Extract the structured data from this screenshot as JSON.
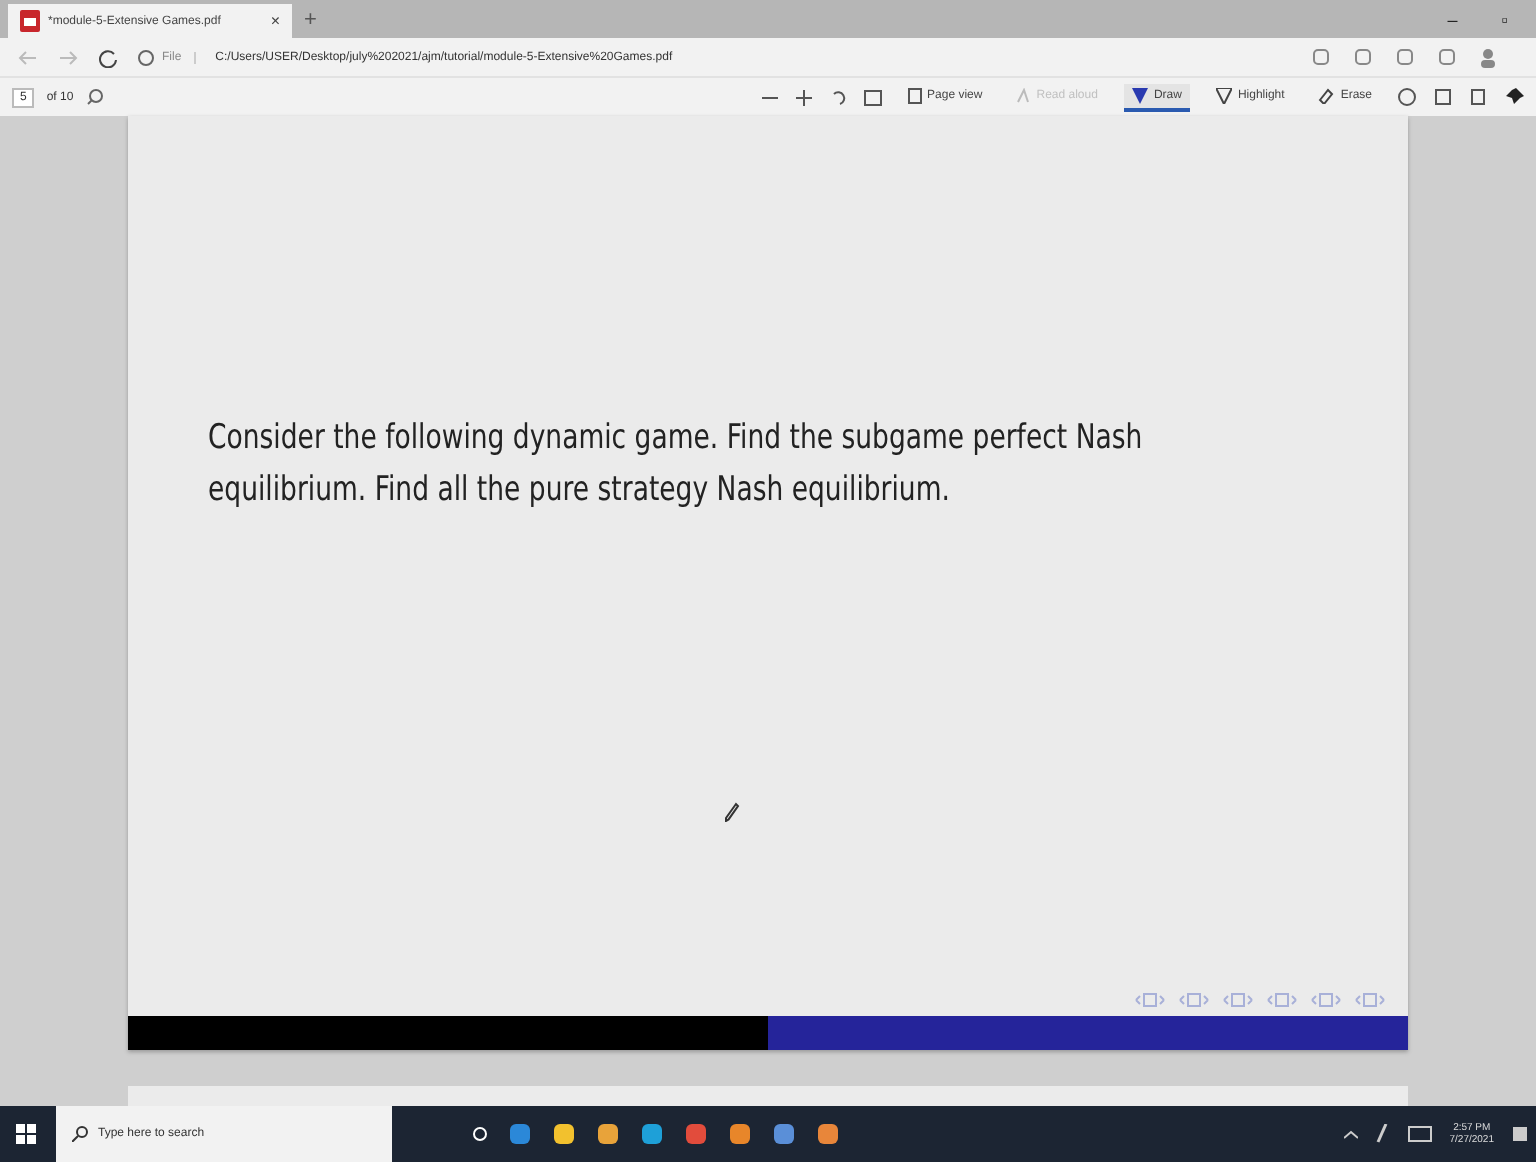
{
  "browser": {
    "tab": {
      "title": "*module-5-Extensive Games.pdf",
      "close": "×"
    },
    "new_tab": "+",
    "window_controls": [
      "–",
      "▫"
    ],
    "address": {
      "scheme": "File",
      "url": "C:/Users/USER/Desktop/july%202021/ajm/tutorial/module-5-Extensive%20Games.pdf"
    }
  },
  "pdf_toolbar": {
    "page": "5",
    "page_count": "of 10",
    "tools": [
      {
        "kind": "view",
        "label": "Page view",
        "disabled": false,
        "selected": false
      },
      {
        "kind": "read",
        "label": "Read aloud",
        "disabled": true,
        "selected": false
      },
      {
        "kind": "draw",
        "label": "Draw",
        "disabled": false,
        "selected": true
      },
      {
        "kind": "highlight",
        "label": "Highlight",
        "disabled": false,
        "selected": false
      },
      {
        "kind": "erase",
        "label": "Erase",
        "disabled": false,
        "selected": false
      }
    ]
  },
  "slide": {
    "text": "Consider the following dynamic game. Find the subgame perfect Nash equilibrium. Find all the pure strategy Nash equilibrium."
  },
  "taskbar": {
    "search_placeholder": "Type here to search",
    "time": "2:57 PM",
    "date": "7/27/2021"
  }
}
